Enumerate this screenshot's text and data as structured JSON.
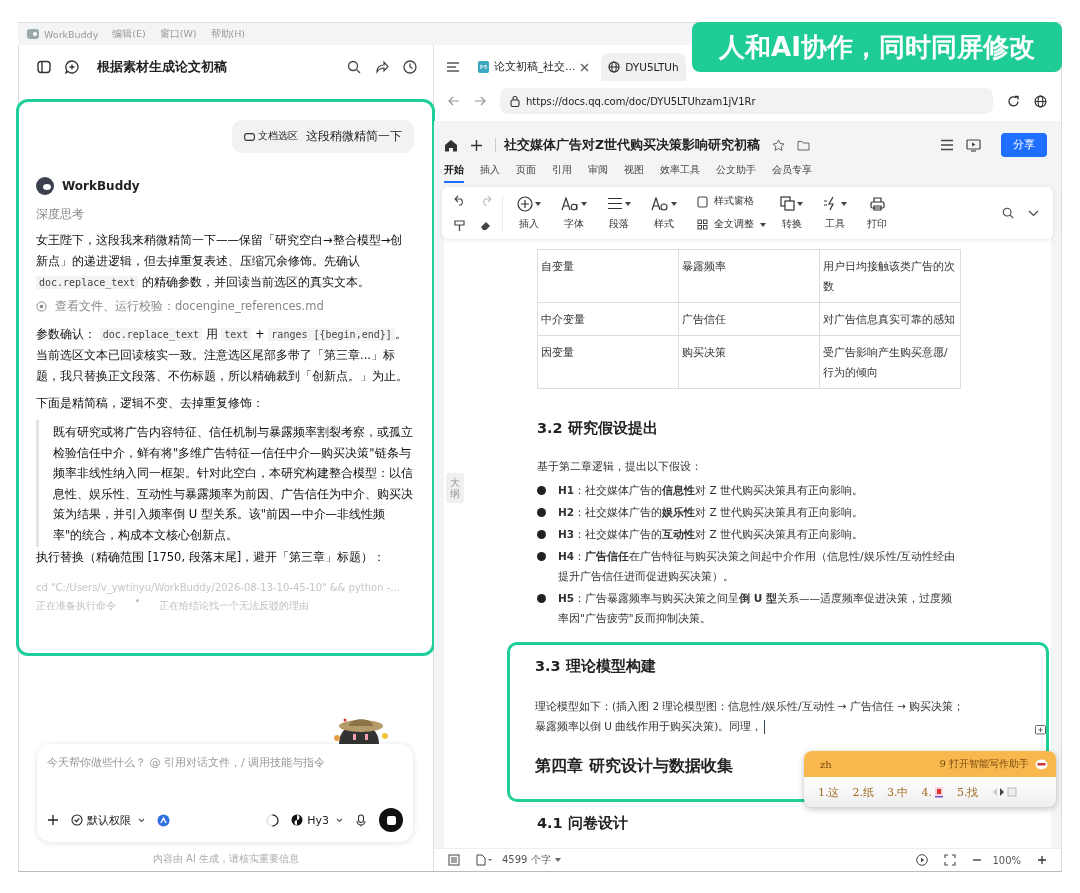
{
  "menu_bar": {
    "app_name": "WorkBuddy",
    "items": [
      "编辑(E)",
      "窗口(W)",
      "帮助(H)"
    ]
  },
  "banner": "人和AI协作，同时同屏修改",
  "chat": {
    "title": "根据素材生成论文初稿",
    "user_message": {
      "tag": "文档选区",
      "text": "这段稍微精简一下"
    },
    "assistant_name": "WorkBuddy",
    "thinking": "深度思考",
    "blocks": [
      {
        "kind": "paragraph",
        "segments": [
          {
            "kind": "text",
            "text": "女王陛下，这段我来稍微精简一下——保留「研究空白→整合模型→创新点」的递进逻辑，但去掉重复表述、压缩冗余修饰。先确认 "
          },
          {
            "kind": "code",
            "text": "doc.replace_text"
          },
          {
            "kind": "text",
            "text": " 的精确参数，并回读当前选区的真实文本。"
          }
        ]
      },
      {
        "kind": "tool",
        "text": "查看文件、运行校验：docengine_references.md"
      },
      {
        "kind": "paragraph",
        "segments": [
          {
            "kind": "text",
            "text": "参数确认： "
          },
          {
            "kind": "code",
            "text": "doc.replace_text"
          },
          {
            "kind": "text",
            "text": " 用 "
          },
          {
            "kind": "code",
            "text": "text"
          },
          {
            "kind": "text",
            "text": " + "
          },
          {
            "kind": "code",
            "text": "ranges [{begin,end}]"
          },
          {
            "kind": "text",
            "text": "。当前选区文本已回读核实一致。注意选区尾部多带了「第三章...」标题，我只替换正文段落、不伤标题，所以精确裁到「创新点。」为止。"
          }
        ]
      },
      {
        "kind": "paragraph",
        "segments": [
          {
            "kind": "text",
            "text": "下面是精简稿，逻辑不变、去掉重复修饰："
          }
        ]
      },
      {
        "kind": "quote",
        "text": "既有研究或将广告内容特征、信任机制与暴露频率割裂考察，或孤立检验信任中介，鲜有将\"多维广告特征—信任中介—购买决策\"链条与频率非线性纳入同一框架。针对此空白，本研究构建整合模型：以信息性、娱乐性、互动性与暴露频率为前因、广告信任为中介、购买决策为结果，并引入频率倒 U 型关系。该\"前因—中介—非线性频率\"的统合，构成本文核心创新点。"
      },
      {
        "kind": "paragraph",
        "segments": [
          {
            "kind": "text",
            "text": "执行替换（精确范围 [1750, 段落末尾]，避开「第三章」标题）："
          }
        ]
      },
      {
        "kind": "command",
        "text": "cd \"C:/Users/v_ywtinyu/WorkBuddy/2026-08-13-10-45-10\" && python -..."
      }
    ],
    "status": [
      "正在准备执行命令",
      "正在给结论找一个无法反驳的理由"
    ],
    "input_placeholder": "今天帮你做些什么？ @ 引用对话文件，/ 调用技能与指令",
    "permission": "默认权限",
    "model": "Hy3",
    "disclaimer": "内容由 AI 生成，请核实重要信息"
  },
  "browser": {
    "tabs": [
      {
        "label": "论文初稿_社交...",
        "selected": true
      },
      {
        "label": "DYU5LTUh",
        "selected": false
      }
    ],
    "url": "https://docs.qq.com/doc/DYU5LTUhzam1jV1Rr"
  },
  "document": {
    "title": "社交媒体广告对Z世代购买决策影响研究初稿",
    "share": "分享",
    "ribbon_tabs": [
      {
        "label": "开始",
        "selected": true
      },
      {
        "label": "插入",
        "selected": false
      },
      {
        "label": "页面",
        "selected": false
      },
      {
        "label": "引用",
        "selected": false
      },
      {
        "label": "审阅",
        "selected": false
      },
      {
        "label": "视图",
        "selected": false
      },
      {
        "label": "效率工具",
        "selected": false
      },
      {
        "label": "公文助手",
        "selected": false
      },
      {
        "label": "会员专享",
        "selected": false
      }
    ],
    "toolbar": [
      {
        "kind": "insert",
        "label": "插入"
      },
      {
        "kind": "font",
        "label": "字体"
      },
      {
        "kind": "paragraph",
        "label": "段落"
      },
      {
        "kind": "style",
        "label": "样式"
      },
      {
        "kind": "panes",
        "label": "样式窗格",
        "label2": "全文调整"
      },
      {
        "kind": "convert",
        "label": "转换"
      },
      {
        "kind": "tools",
        "label": "工具"
      },
      {
        "kind": "print",
        "label": "打印"
      }
    ],
    "outline_tab": "大纲",
    "table": [
      [
        "自变量",
        "暴露频率",
        "用户日均接触该类广告的次数"
      ],
      [
        "中介变量",
        "广告信任",
        "对广告信息真实可靠的感知"
      ],
      [
        "因变量",
        "购买决策",
        "受广告影响产生购买意愿/行为的倾向"
      ]
    ],
    "heading_3_2": "3.2  研究假设提出",
    "intro": "基于第二章逻辑，提出以下假设：",
    "hypotheses": [
      "**H1**：社交媒体广告的**信息性**对 Z 世代购买决策具有正向影响。",
      "**H2**：社交媒体广告的**娱乐性**对 Z 世代购买决策具有正向影响。",
      "**H3**：社交媒体广告的**互动性**对 Z 世代购买决策具有正向影响。",
      "**H4**：**广告信任**在广告特征与购买决策之间起中介作用（信息性/娱乐性/互动性经由提升广告信任进而促进购买决策）。",
      "**H5**：广告暴露频率与购买决策之间呈**倒 U 型**关系——适度频率促进决策，过度频率因\"广告疲劳\"反而抑制决策。"
    ],
    "heading_3_3": "3.3  理论模型构建",
    "model_text": "理论模型如下：(插入图 2 理论模型图：信息性/娱乐性/互动性 → 广告信任 → 购买决策；暴露频率以倒 U 曲线作用于购买决策)。同理，",
    "chapter_4": "第四章  研究设计与数据收集",
    "heading_4_1": "4.1  问卷设计",
    "word_count": "4599 个字",
    "zoom": "100%"
  },
  "ime": {
    "input": "zh",
    "hint": "9 打开智能写作助手",
    "candidates": [
      {
        "kind": "text",
        "index": "1.",
        "text": "这"
      },
      {
        "kind": "text",
        "index": "2.",
        "text": "纸"
      },
      {
        "kind": "text",
        "index": "3.",
        "text": "中"
      },
      {
        "kind": "icon",
        "index": "4."
      },
      {
        "kind": "text",
        "index": "5.",
        "text": "找"
      }
    ]
  }
}
